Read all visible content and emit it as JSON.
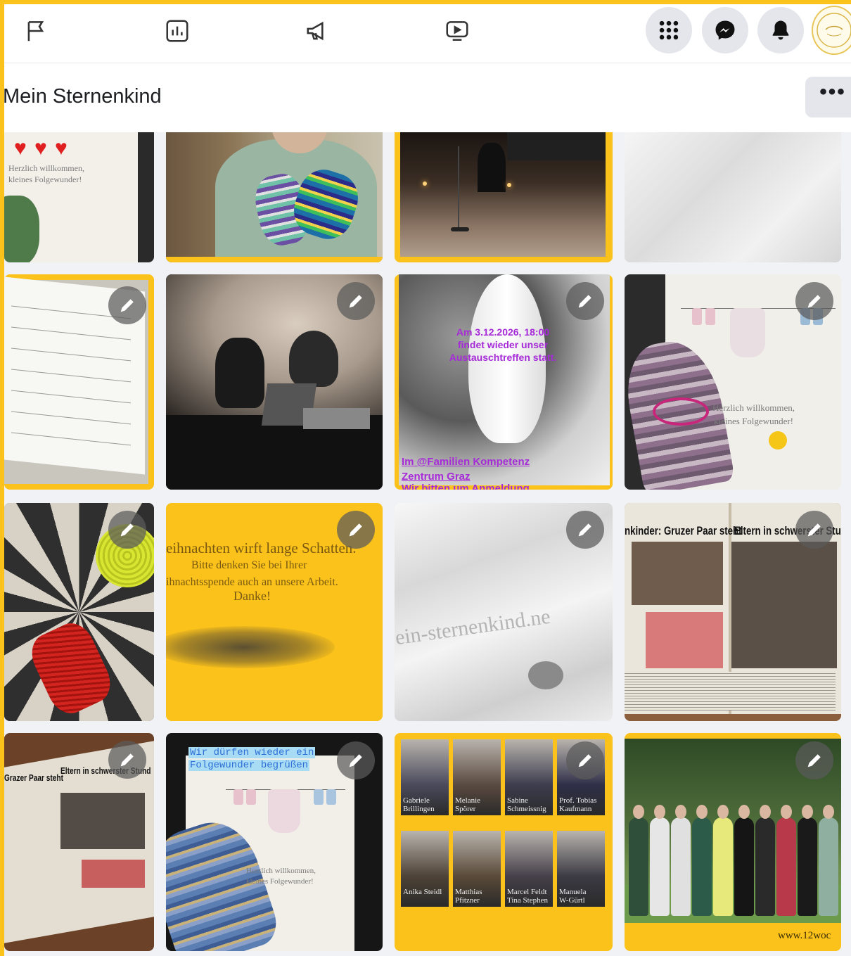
{
  "header": {
    "page_title": "Mein Sternenkind",
    "more_label": "•••"
  },
  "nav_icons": [
    "flag-icon",
    "insights-icon",
    "megaphone-icon",
    "video-icon",
    "apps-grid-icon",
    "messenger-icon",
    "bell-icon"
  ],
  "colors": {
    "frame": "#fbc21b",
    "nav_button_bg": "#e4e6eb",
    "purple_caption": "#9b2fd0",
    "highlight": "#8fd3f4"
  },
  "posts": {
    "welcome_card_top": {
      "line1": "Herzlich willkommen,",
      "line2": "kleines Folgewunder!"
    },
    "event_post": {
      "line1": "Am 3.12.2026, 18:00",
      "line2": "findet wieder unser",
      "line3": "Austauschtreffen statt.",
      "line4": "Im @Familien Kompetenz",
      "line5": "Zentrum Graz",
      "line6": "Wir bitten um Anmeldung"
    },
    "welcome_card_right": {
      "line1": "Herzlich willkommen,",
      "line2": "kleines Folgewunder!"
    },
    "christmas_post": {
      "line1": "eihnachten wirft lange Schatten.",
      "line2": "Bitte denken Sie bei Ihrer",
      "line3": "ihnachtsspende auch an unsere Arbeit.",
      "line4": "Danke!"
    },
    "watermark_post": {
      "text": "ein-sternenkind.ne"
    },
    "newspaper_post": {
      "headline_left": "nkinder: Gruzer Paar steht",
      "headline_right": "Eltern in schwerster Stun"
    },
    "newspaper_post_2": {
      "headline_left": "Grazer Paar steht",
      "headline_right": "Eltern in schwerster Stund"
    },
    "folgewunder_post": {
      "line1": "Wir dürfen wieder ein",
      "line2": "Folgewunder begrüßen",
      "card_line1": "Herzlich willkommen,",
      "card_line2": "kleines Folgewunder!"
    },
    "collage_post": {
      "names": [
        "Gabriele\nBrillingen",
        "Melanie\nSpörer",
        "Sabine\nSchmeissnig",
        "Prof. Tobias\nKaufmann",
        "Anika Steidl",
        "Matthias\nPfitzner",
        "Marcel Feldt\nTina Stephen",
        "Manuela\nW-Gürtl"
      ]
    },
    "group_photo_post": {
      "watermark": "www.12woc"
    }
  }
}
